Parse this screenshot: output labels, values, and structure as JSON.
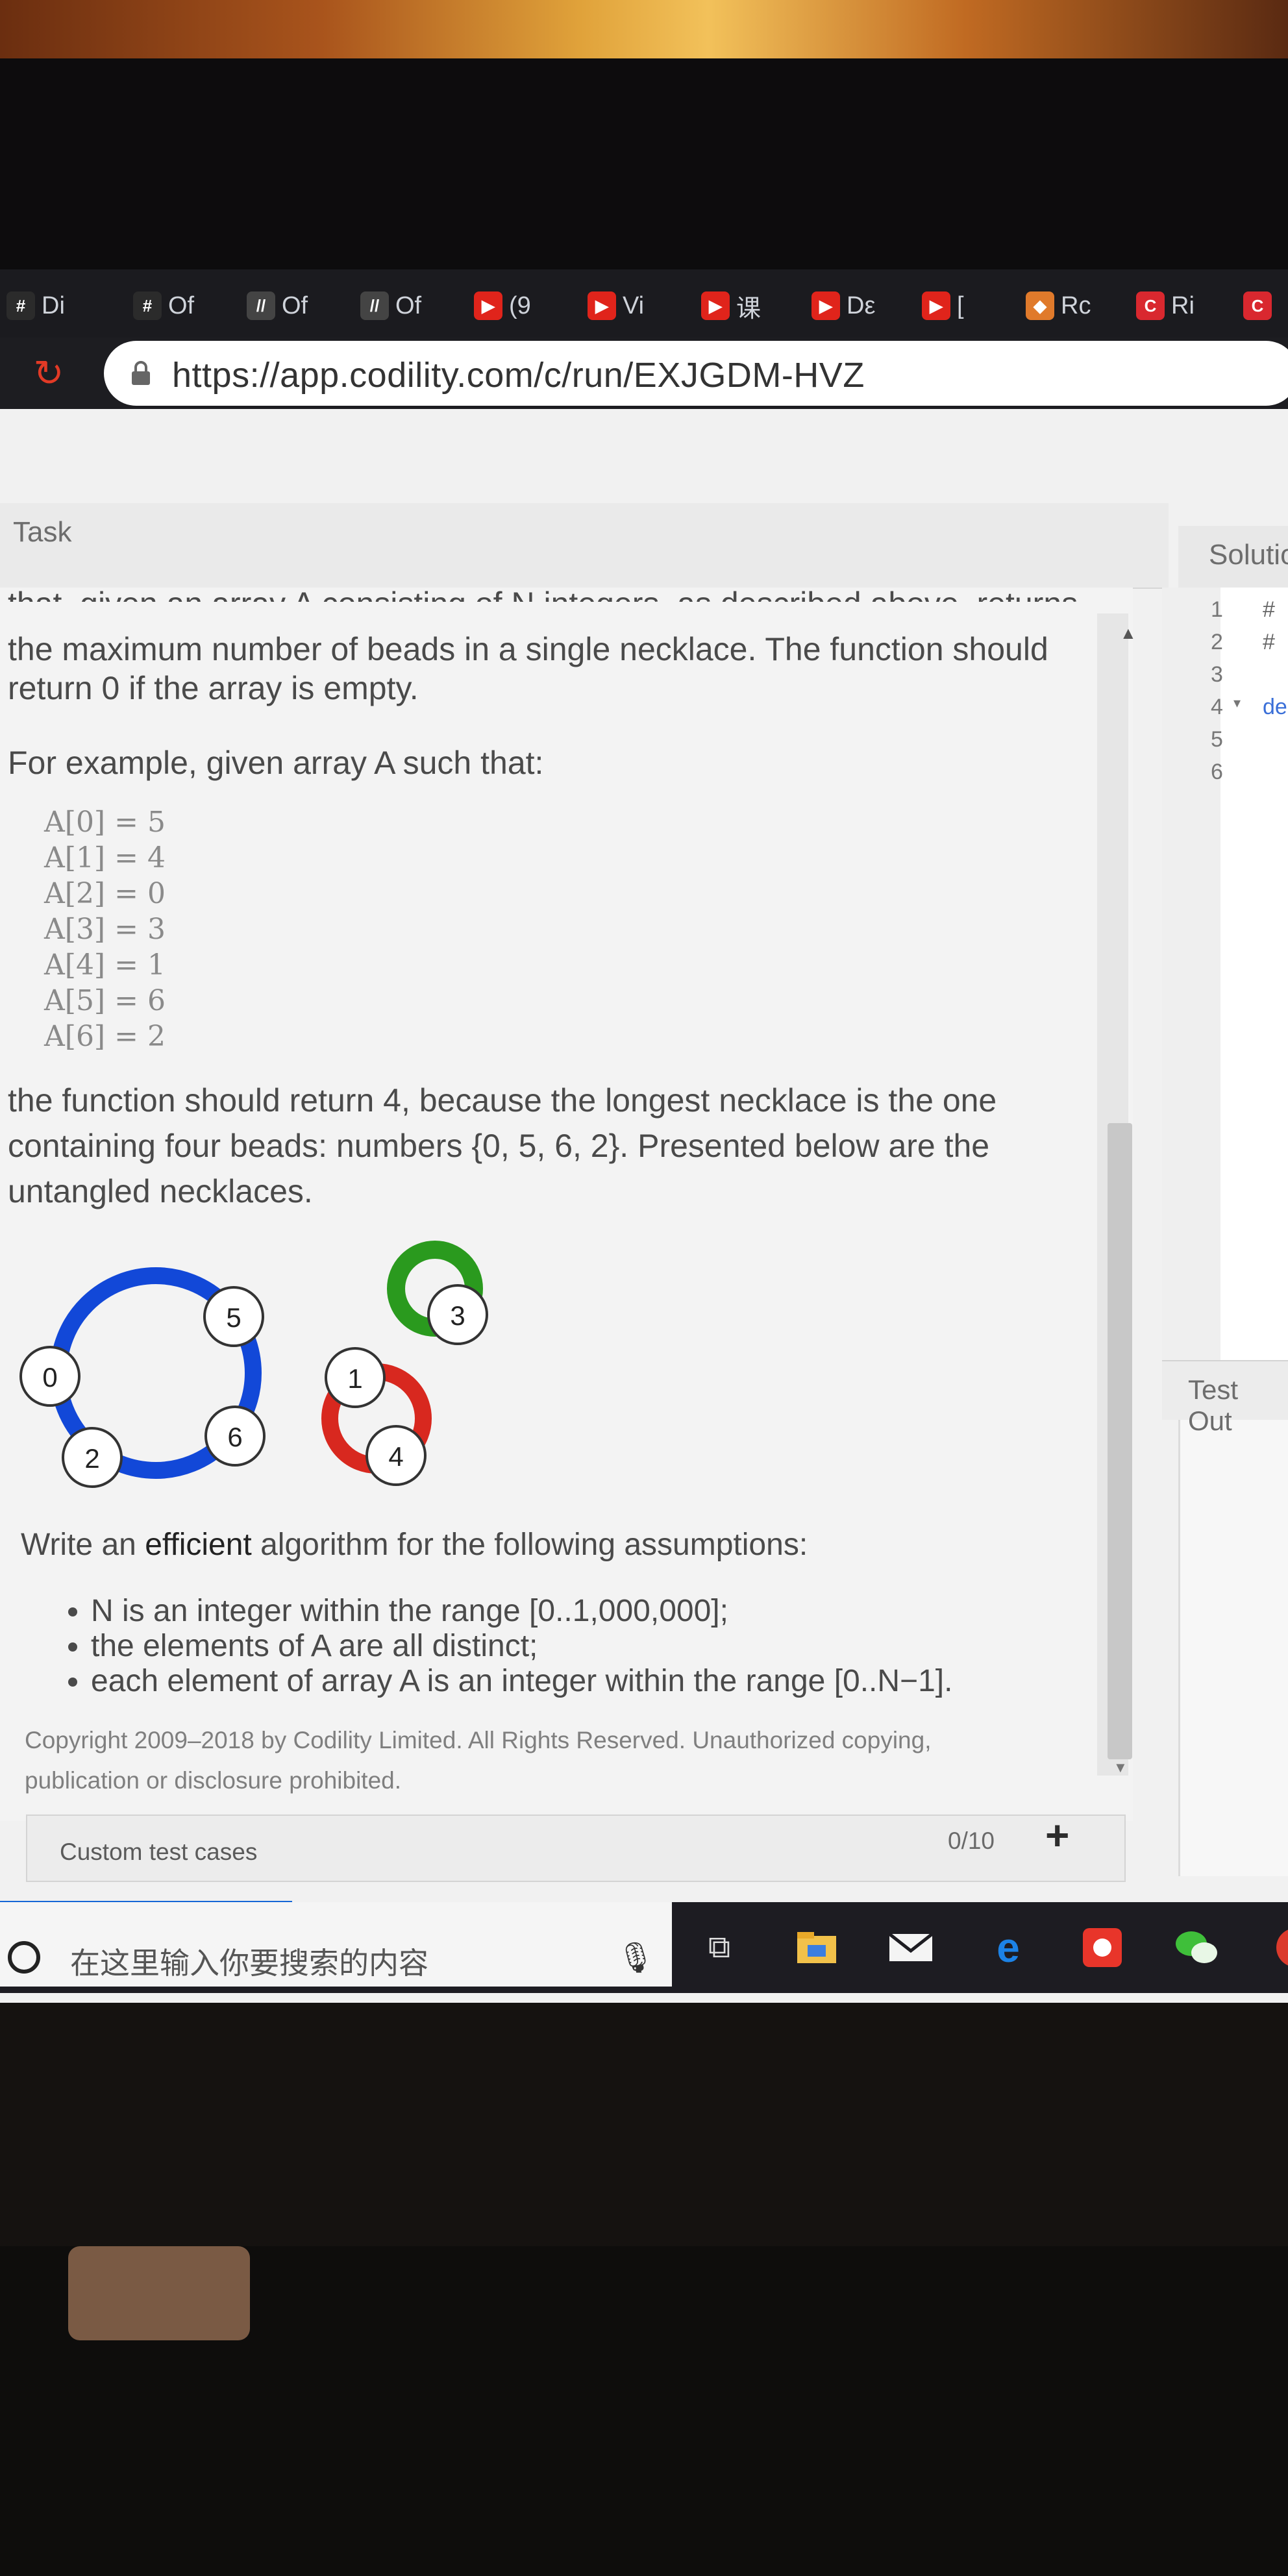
{
  "browser": {
    "tabs": [
      {
        "label": "Di",
        "icon": "hash-icon",
        "color": "#2b2b2b"
      },
      {
        "label": "Of",
        "icon": "hash-icon",
        "color": "#2b2b2b"
      },
      {
        "label": "Of",
        "icon": "stripes-icon",
        "color": "#444444"
      },
      {
        "label": "Of",
        "icon": "stripes-icon",
        "color": "#444444"
      },
      {
        "label": "(9",
        "icon": "youtube-icon",
        "color": "#e0241b"
      },
      {
        "label": "Vi",
        "icon": "youtube-icon",
        "color": "#e0241b"
      },
      {
        "label": "课",
        "icon": "youtube-icon",
        "color": "#e0241b"
      },
      {
        "label": "Dε",
        "icon": "youtube-icon",
        "color": "#e0241b"
      },
      {
        "label": "[",
        "icon": "youtube-icon",
        "color": "#e0241b"
      },
      {
        "label": "Rc",
        "icon": "orange-app-icon",
        "color": "#e07a2b"
      },
      {
        "label": "Ri",
        "icon": "codility-icon",
        "color": "#d9282f"
      },
      {
        "label": "",
        "icon": "codility-icon",
        "color": "#d9282f"
      }
    ],
    "url": "https://app.codility.com/c/run/EXJGDM-HVZ"
  },
  "task": {
    "title": "Task",
    "cut_line": "that, given an array A consisting of N integers, as described above, returns",
    "intro_1": "the maximum number of beads in a single necklace. The function should",
    "intro_2": "return 0 if the array is empty.",
    "example_intro": "For example, given array A such that:",
    "array_lines": [
      "A[0] = 5",
      "A[1] = 4",
      "A[2] = 0",
      "A[3] = 3",
      "A[4] = 1",
      "A[5] = 6",
      "A[6] = 2"
    ],
    "result_1": "the function should return 4, because the longest necklace is the one",
    "result_2": "containing four beads: numbers {0, 5, 6, 2}. Presented below are the",
    "result_3": "untangled necklaces.",
    "assumptions_prefix": "Write an ",
    "assumptions_bold": "efficient",
    "assumptions_suffix": " algorithm for the following assumptions:",
    "bullets": [
      "N is an integer within the range [0..1,000,000];",
      "the elements of A are all distinct;",
      "each element of array A is an integer within the range [0..N−1]."
    ],
    "copyright_1": "Copyright 2009–2018 by Codility Limited. All Rights Reserved. Unauthorized copying,",
    "copyright_2": "publication or disclosure prohibited.",
    "necklaces": {
      "blue": {
        "color": "#1248d8",
        "beads": [
          "5",
          "0",
          "6",
          "2"
        ]
      },
      "green": {
        "color": "#2a9a1e",
        "beads": [
          "3"
        ]
      },
      "red": {
        "color": "#d8281f",
        "beads": [
          "1",
          "4"
        ]
      }
    }
  },
  "custom_tests": {
    "label": "Custom test cases",
    "count": "0/10",
    "add": "+"
  },
  "solution": {
    "title": "Solutio",
    "line_numbers": [
      "1",
      "2",
      "3",
      "4",
      "5",
      "6"
    ],
    "tokens": {
      "l1": "#",
      "l2": "#",
      "l4": "de"
    },
    "fold_marker": "▾",
    "test_output_title": "Test Out"
  },
  "taskbar": {
    "search_placeholder": "在这里输入你要搜索的内容",
    "icons": [
      "task-view-icon",
      "file-explorer-icon",
      "mail-icon",
      "edge-icon",
      "app-red-icon",
      "wechat-icon",
      "chrome-icon"
    ]
  }
}
